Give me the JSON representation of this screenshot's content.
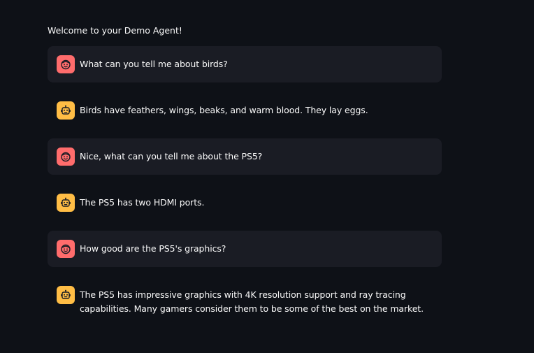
{
  "page": {
    "welcome": "Welcome to your Demo Agent!"
  },
  "colors": {
    "background": "#0e1117",
    "user_bubble": "#1a1c24",
    "user_avatar": "#ff6c6c",
    "assistant_avatar": "#ffbd45",
    "text": "#fafafa"
  },
  "messages": [
    {
      "role": "user",
      "avatar_icon": "smiley-face-icon",
      "text": "What can you tell me about birds?"
    },
    {
      "role": "assistant",
      "avatar_icon": "robot-face-icon",
      "text": "Birds have feathers, wings, beaks, and warm blood. They lay eggs."
    },
    {
      "role": "user",
      "avatar_icon": "smiley-face-icon",
      "text": "Nice, what can you tell me about the PS5?"
    },
    {
      "role": "assistant",
      "avatar_icon": "robot-face-icon",
      "text": "The PS5 has two HDMI ports."
    },
    {
      "role": "user",
      "avatar_icon": "smiley-face-icon",
      "text": "How good are the PS5's graphics?"
    },
    {
      "role": "assistant",
      "avatar_icon": "robot-face-icon",
      "text": "The PS5 has impressive graphics with 4K resolution support and ray tracing capabilities. Many gamers consider them to be some of the best on the market."
    }
  ]
}
